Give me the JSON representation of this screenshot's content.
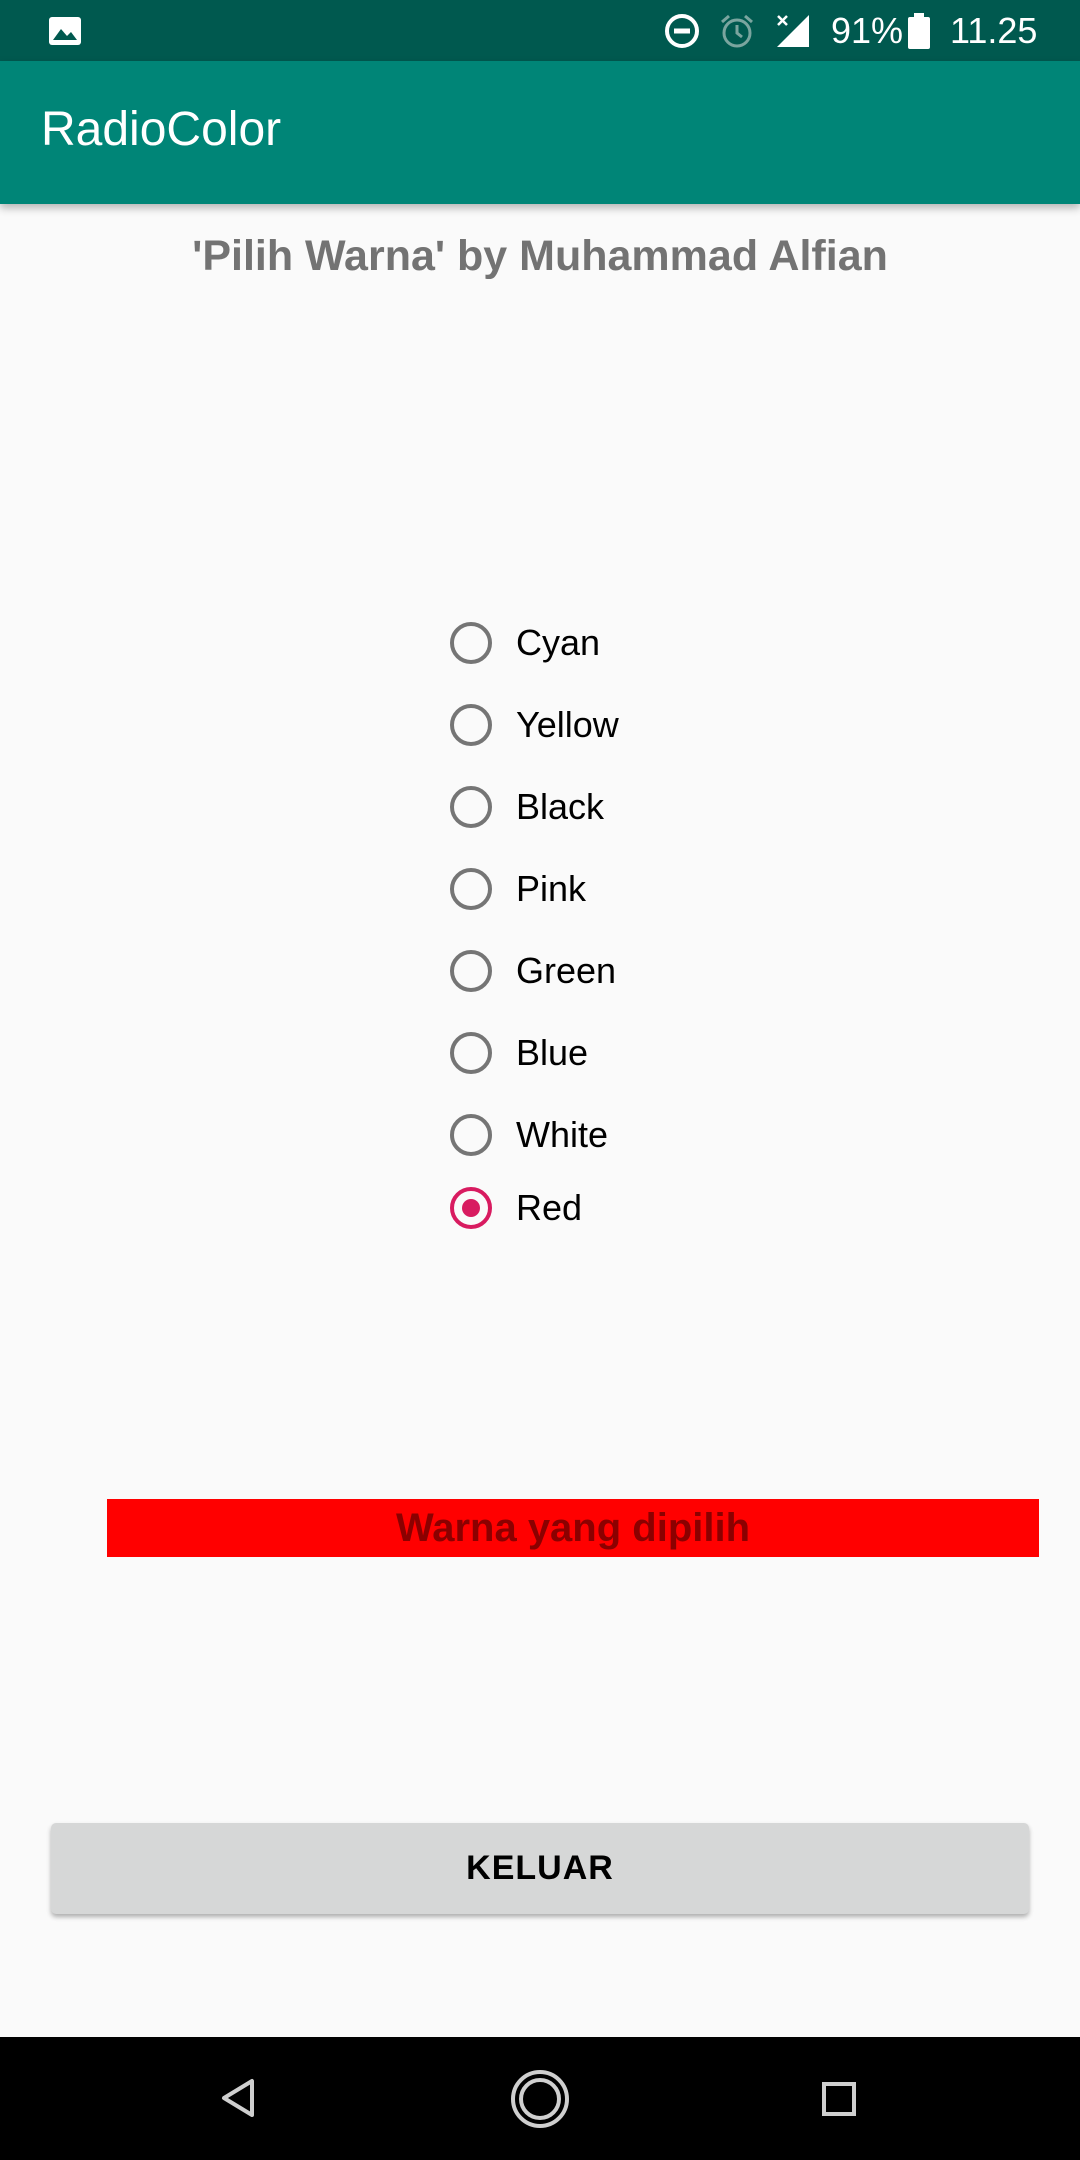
{
  "status_bar": {
    "left_icon": "image-icon",
    "icons": [
      "do-not-disturb-icon",
      "alarm-icon",
      "signal-icon",
      "battery-icon"
    ],
    "battery_percent": "91%",
    "time": "11.25"
  },
  "app_bar": {
    "title": "RadioColor",
    "color": "#008577"
  },
  "heading": "'Pilih Warna' by Muhammad Alfian",
  "radio_group": {
    "options": [
      {
        "label": "Cyan",
        "checked": false
      },
      {
        "label": "Yellow",
        "checked": false
      },
      {
        "label": "Black",
        "checked": false
      },
      {
        "label": "Pink",
        "checked": false
      },
      {
        "label": "Green",
        "checked": false
      },
      {
        "label": "Blue",
        "checked": false
      },
      {
        "label": "White",
        "checked": false
      },
      {
        "label": "Red",
        "checked": true
      }
    ],
    "accent_color": "#d81b60"
  },
  "result": {
    "text": "Warna yang dipilih",
    "background": "#ff0000"
  },
  "exit_button": {
    "label": "KELUAR"
  },
  "nav_bar": {
    "icons": [
      "back-icon",
      "home-icon",
      "recents-icon"
    ]
  }
}
